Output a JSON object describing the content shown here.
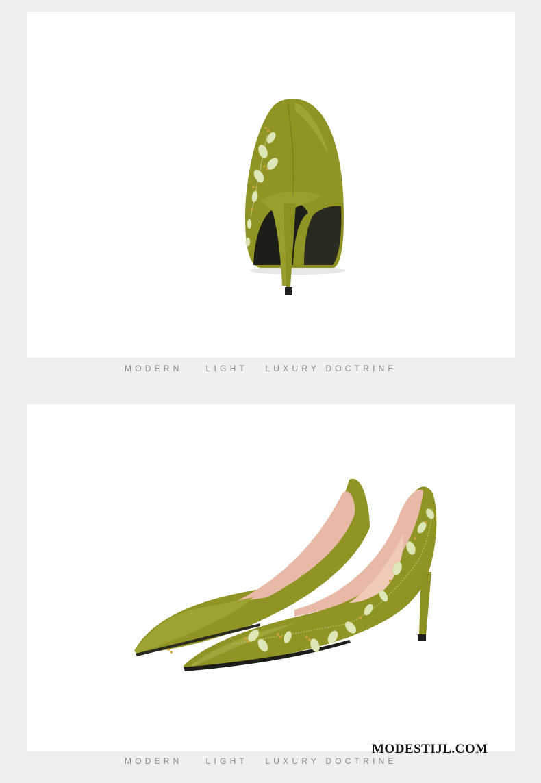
{
  "panels": {
    "top": {
      "product_view": "rear view of olive-green pointed pump with embroidered floral vine",
      "caption": "MODERN    LIGHT   LUXURY DOCTRINE"
    },
    "bottom": {
      "product_view": "pair of olive-green pointed stiletto pumps with embroidered leaves",
      "caption": "MODERN    LIGHT   LUXURY DOCTRINE"
    }
  },
  "watermark": "MODESTIJL.COM",
  "colors": {
    "page_background": "#efefef",
    "panel_background": "#ffffff",
    "shoe_leather": "#8f9424",
    "shoe_lining": "#e8b9a6",
    "embroidery": "#dfe7b8",
    "caption_text": "#8a8a8a"
  }
}
